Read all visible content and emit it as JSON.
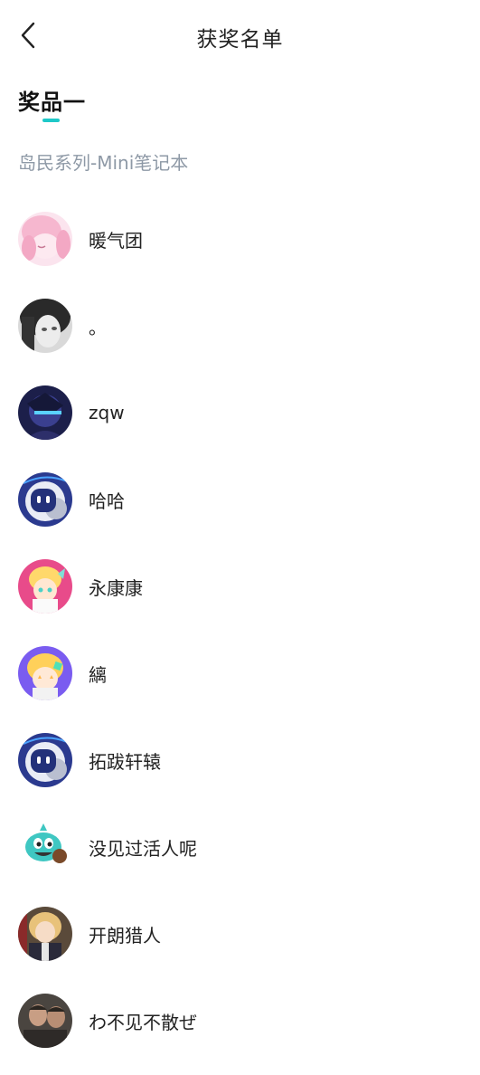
{
  "header": {
    "title": "获奖名单",
    "back_icon": "chevron-left-icon"
  },
  "prize": {
    "title": "奖品一",
    "accent_color": "#1ec8c8",
    "name": "岛民系列-Mini笔记本"
  },
  "winners": [
    {
      "name": "暖气团"
    },
    {
      "name": "。"
    },
    {
      "name": "zqw"
    },
    {
      "name": "哈哈"
    },
    {
      "name": "永康康"
    },
    {
      "name": "縭"
    },
    {
      "name": "拓跋轩辕"
    },
    {
      "name": "没见过活人呢"
    },
    {
      "name": "开朗猎人"
    },
    {
      "name": "わ不见不散ぜ"
    }
  ]
}
